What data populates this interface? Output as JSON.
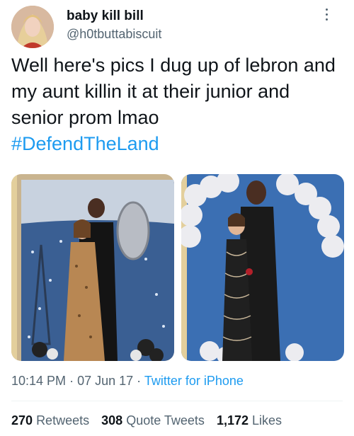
{
  "tweet": {
    "display_name": "baby kill bill",
    "handle": "@h0tbuttabiscuit",
    "text": "Well here's pics I dug up of lebron and my aunt killin it at their junior and senior prom lmao",
    "hashtag": "#DefendTheLand",
    "time": "10:14 PM",
    "date": "07 Jun 17",
    "source": "Twitter for iPhone",
    "separator": "·"
  },
  "stats": {
    "retweets_count": "270",
    "retweets_label": "Retweets",
    "quote_count": "308",
    "quote_label": "Quote Tweets",
    "likes_count": "1,172",
    "likes_label": "Likes"
  },
  "colors": {
    "link": "#1d9bf0",
    "secondary_text": "#536471",
    "primary_text": "#0f1419"
  },
  "icons": {
    "more": "more-options-icon"
  }
}
